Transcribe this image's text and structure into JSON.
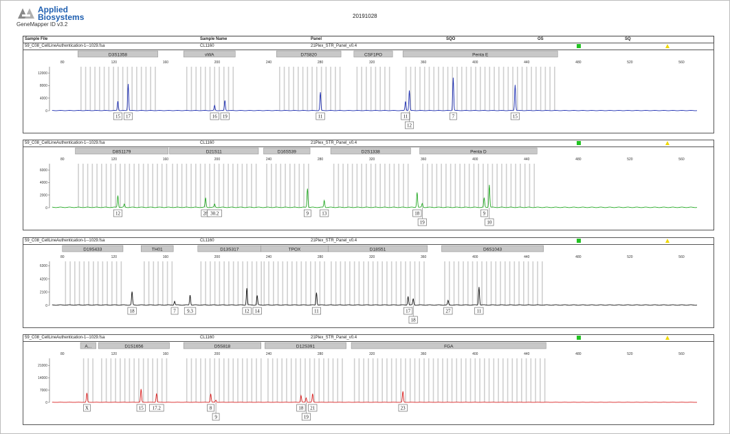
{
  "header": {
    "brand_line1": "Applied",
    "brand_line2": "Biosystems",
    "version": "GeneMapper ID v3.2",
    "date": "20191028"
  },
  "columns": [
    "Sample File",
    "Sample Name",
    "Panel",
    "SQO",
    "OS",
    "SQ"
  ],
  "colors": {
    "blue": "#1a2bb0",
    "green": "#23a823",
    "black": "#111111",
    "red": "#d81c1c",
    "bin": "#cfcfcf"
  },
  "icons": [
    "applied-biosystems-logo",
    "status-green-square-icon",
    "status-yellow-triangle-icon"
  ],
  "size_axis": {
    "min": 70,
    "max": 580,
    "ticks": [
      80,
      120,
      160,
      200,
      240,
      280,
      320,
      360,
      400,
      440,
      480,
      520,
      560
    ]
  },
  "panels": [
    {
      "sample_file": "59_C08_CellLineAuthentication-1--1029.fsa",
      "sample_name": "CL1160",
      "panel": "21Plex_STR_Panel_v0.4",
      "color": "blue",
      "y_ticks": [
        "12000",
        "8000",
        "4000",
        "0"
      ],
      "y_max": 14000,
      "loci": [
        {
          "name": "D3S1358",
          "start": 92,
          "end": 154
        },
        {
          "name": "vWA",
          "start": 174,
          "end": 214
        },
        {
          "name": "D7S820",
          "start": 246,
          "end": 296
        },
        {
          "name": "CSF1PO",
          "start": 306,
          "end": 336
        },
        {
          "name": "Penta E",
          "start": 344,
          "end": 464
        }
      ],
      "peaks": [
        {
          "x": 123,
          "h": 3000
        },
        {
          "x": 131,
          "h": 8500
        },
        {
          "x": 198,
          "h": 1600
        },
        {
          "x": 206,
          "h": 3200
        },
        {
          "x": 280,
          "h": 5800
        },
        {
          "x": 346,
          "h": 2900
        },
        {
          "x": 349,
          "h": 6400
        },
        {
          "x": 383,
          "h": 10500
        },
        {
          "x": 431,
          "h": 8200
        }
      ],
      "alleles": [
        {
          "label": "15",
          "x": 123,
          "row": 0
        },
        {
          "label": "17",
          "x": 131,
          "row": 0
        },
        {
          "label": "16",
          "x": 198,
          "row": 0
        },
        {
          "label": "19",
          "x": 206,
          "row": 0
        },
        {
          "label": "11",
          "x": 280,
          "row": 0
        },
        {
          "label": "11",
          "x": 346,
          "row": 0
        },
        {
          "label": "12",
          "x": 349,
          "row": 1
        },
        {
          "label": "7",
          "x": 383,
          "row": 0
        },
        {
          "label": "15",
          "x": 431,
          "row": 0
        }
      ]
    },
    {
      "sample_file": "59_C08_CellLineAuthentication-1--1029.fsa",
      "sample_name": "CL1160",
      "panel": "21Plex_STR_Panel_v0.4",
      "color": "green",
      "y_ticks": [
        "6000",
        "4000",
        "2000",
        "0"
      ],
      "y_max": 7000,
      "loci": [
        {
          "name": "D8S1179",
          "start": 90,
          "end": 162
        },
        {
          "name": "D21S11",
          "start": 163,
          "end": 232
        },
        {
          "name": "D16S539",
          "start": 236,
          "end": 272
        },
        {
          "name": "D2S1338",
          "start": 288,
          "end": 350
        },
        {
          "name": "Penta D",
          "start": 357,
          "end": 448
        }
      ],
      "peaks": [
        {
          "x": 123,
          "h": 1900
        },
        {
          "x": 128,
          "h": 500
        },
        {
          "x": 191,
          "h": 1500
        },
        {
          "x": 198,
          "h": 500
        },
        {
          "x": 270,
          "h": 3000
        },
        {
          "x": 283,
          "h": 1100
        },
        {
          "x": 355,
          "h": 2400
        },
        {
          "x": 359,
          "h": 600
        },
        {
          "x": 407,
          "h": 1500
        },
        {
          "x": 411,
          "h": 3600
        }
      ],
      "alleles": [
        {
          "label": "12",
          "x": 123,
          "row": 0
        },
        {
          "label": "28",
          "x": 191,
          "row": 0
        },
        {
          "label": "30.2",
          "x": 198,
          "row": 0
        },
        {
          "label": "9",
          "x": 270,
          "row": 0
        },
        {
          "label": "13",
          "x": 283,
          "row": 0
        },
        {
          "label": "18",
          "x": 355,
          "row": 0
        },
        {
          "label": "19",
          "x": 359,
          "row": 1
        },
        {
          "label": "9",
          "x": 407,
          "row": 0
        },
        {
          "label": "10",
          "x": 411,
          "row": 1
        }
      ]
    },
    {
      "sample_file": "59_C08_CellLineAuthentication-1--1029.fsa",
      "sample_name": "CL1160",
      "panel": "21Plex_STR_Panel_v0.4",
      "color": "black",
      "y_ticks": [
        "6300",
        "4200",
        "2100",
        "0"
      ],
      "y_max": 7000,
      "loci": [
        {
          "name": "D19S433",
          "start": 80,
          "end": 127
        },
        {
          "name": "TH01",
          "start": 141,
          "end": 166
        },
        {
          "name": "D13S317",
          "start": 185,
          "end": 234
        },
        {
          "name": "TPOX",
          "start": 234,
          "end": 286
        },
        {
          "name": "D18S51",
          "start": 286,
          "end": 363
        },
        {
          "name": "D6S1043",
          "start": 374,
          "end": 453
        }
      ],
      "peaks": [
        {
          "x": 134,
          "h": 2100
        },
        {
          "x": 167,
          "h": 600
        },
        {
          "x": 179,
          "h": 1600
        },
        {
          "x": 223,
          "h": 2700
        },
        {
          "x": 231,
          "h": 1500
        },
        {
          "x": 277,
          "h": 2000
        },
        {
          "x": 348,
          "h": 1400
        },
        {
          "x": 352,
          "h": 1000
        },
        {
          "x": 379,
          "h": 700
        },
        {
          "x": 403,
          "h": 2900
        }
      ],
      "alleles": [
        {
          "label": "18",
          "x": 134,
          "row": 0
        },
        {
          "label": "7",
          "x": 167,
          "row": 0
        },
        {
          "label": "9.3",
          "x": 179,
          "row": 0
        },
        {
          "label": "12",
          "x": 223,
          "row": 0
        },
        {
          "label": "14",
          "x": 231,
          "row": 0
        },
        {
          "label": "11",
          "x": 277,
          "row": 0
        },
        {
          "label": "17",
          "x": 348,
          "row": 0
        },
        {
          "label": "18",
          "x": 352,
          "row": 1
        },
        {
          "label": "27",
          "x": 379,
          "row": 0
        },
        {
          "label": "11",
          "x": 403,
          "row": 0
        }
      ]
    },
    {
      "sample_file": "59_C08_CellLineAuthentication-1--1029.fsa",
      "sample_name": "CL1160",
      "panel": "21Plex_STR_Panel_v0.4",
      "color": "red",
      "y_ticks": [
        "21000",
        "14000",
        "7000",
        "0"
      ],
      "y_max": 25000,
      "loci": [
        {
          "name": "A...",
          "start": 94,
          "end": 106
        },
        {
          "name": "D1S1656",
          "start": 108,
          "end": 163
        },
        {
          "name": "D5S818",
          "start": 174,
          "end": 234
        },
        {
          "name": "D12S391",
          "start": 237,
          "end": 300
        },
        {
          "name": "FGA",
          "start": 304,
          "end": 455
        }
      ],
      "peaks": [
        {
          "x": 99,
          "h": 5200
        },
        {
          "x": 141,
          "h": 7500
        },
        {
          "x": 153,
          "h": 5000
        },
        {
          "x": 195,
          "h": 4800
        },
        {
          "x": 199,
          "h": 1200
        },
        {
          "x": 265,
          "h": 3800
        },
        {
          "x": 269,
          "h": 2500
        },
        {
          "x": 274,
          "h": 4800
        },
        {
          "x": 344,
          "h": 6200
        }
      ],
      "alleles": [
        {
          "label": "X",
          "x": 99,
          "row": 0
        },
        {
          "label": "15",
          "x": 141,
          "row": 0
        },
        {
          "label": "17.2",
          "x": 153,
          "row": 0
        },
        {
          "label": "8",
          "x": 195,
          "row": 0
        },
        {
          "label": "9",
          "x": 199,
          "row": 1
        },
        {
          "label": "18",
          "x": 265,
          "row": 0
        },
        {
          "label": "19",
          "x": 269,
          "row": 1
        },
        {
          "label": "21",
          "x": 274,
          "row": 0
        },
        {
          "label": "23",
          "x": 344,
          "row": 0
        }
      ]
    }
  ]
}
